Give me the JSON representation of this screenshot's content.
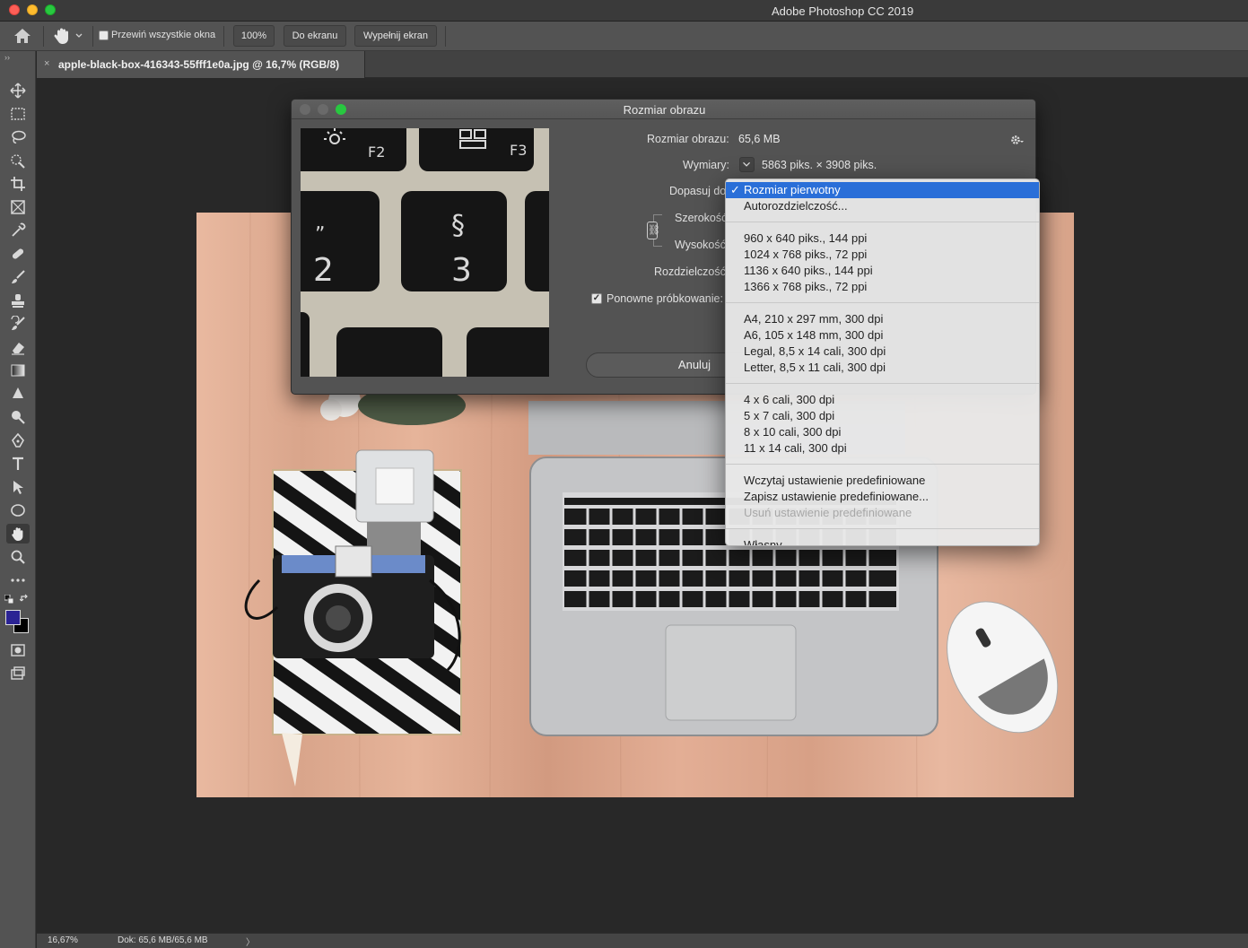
{
  "app": {
    "title": "Adobe Photoshop CC 2019"
  },
  "options_bar": {
    "scroll_all_label": "Przewiń wszystkie okna",
    "buttons": [
      "100%",
      "Do ekranu",
      "Wypełnij ekran"
    ]
  },
  "document": {
    "tab_title": "apple-black-box-416343-55fff1e0a.jpg @ 16,7% (RGB/8)",
    "close_glyph": "×"
  },
  "status_bar": {
    "zoom": "16,67%",
    "doc_info": "Dok: 65,6 MB/65,6 MB",
    "arrow": "〉"
  },
  "dialog": {
    "title": "Rozmiar obrazu",
    "image_size_label": "Rozmiar obrazu:",
    "image_size_value": "65,6 MB",
    "dimensions_label": "Wymiary:",
    "dimensions_value": "5863 piks. × 3908 piks.",
    "fit_to_label": "Dopasuj do:",
    "width_label": "Szerokość:",
    "height_label": "Wysokość:",
    "resolution_label": "Rozdzielczość:",
    "resample_label": "Ponowne próbkowanie:",
    "resample_checked": true,
    "cancel_button": "Anuluj"
  },
  "fit_menu": {
    "groups": [
      [
        {
          "label": "Rozmiar pierwotny",
          "selected": true
        },
        {
          "label": "Autorozdzielczość..."
        }
      ],
      [
        {
          "label": "960 x 640 piks., 144 ppi"
        },
        {
          "label": "1024 x 768 piks., 72 ppi"
        },
        {
          "label": "1136 x 640 piks., 144 ppi"
        },
        {
          "label": "1366 x 768 piks., 72 ppi"
        }
      ],
      [
        {
          "label": "A4, 210 x 297 mm, 300 dpi"
        },
        {
          "label": "A6, 105 x 148 mm, 300 dpi"
        },
        {
          "label": "Legal, 8,5 x 14 cali, 300 dpi"
        },
        {
          "label": "Letter, 8,5 x 11 cali, 300 dpi"
        }
      ],
      [
        {
          "label": "4 x 6 cali, 300 dpi"
        },
        {
          "label": "5 x 7 cali, 300 dpi"
        },
        {
          "label": "8 x 10 cali, 300 dpi"
        },
        {
          "label": "11 x 14 cali, 300 dpi"
        }
      ],
      [
        {
          "label": "Wczytaj ustawienie predefiniowane"
        },
        {
          "label": "Zapisz ustawienie predefiniowane..."
        },
        {
          "label": "Usuń ustawienie predefiniowane",
          "disabled": true
        }
      ],
      [
        {
          "label": "Własny"
        }
      ]
    ]
  },
  "preview_keys": {
    "f2": "F2",
    "f3": "F3",
    "key_quote": "„",
    "key_2": "2",
    "key_section": "§",
    "key_3": "3"
  },
  "colors": {
    "accent_selected": "#2a6fd8",
    "foreground_swatch": "#2b2394",
    "background_swatch": "#000000"
  },
  "tools": [
    "move-icon",
    "marquee-icon",
    "lasso-icon",
    "quick-select-icon",
    "crop-icon",
    "frame-icon",
    "eyedropper-icon",
    "healing-icon",
    "brush-icon",
    "stamp-icon",
    "history-brush-icon",
    "eraser-icon",
    "gradient-icon",
    "blur-icon",
    "dodge-icon",
    "pen-icon",
    "type-icon",
    "path-select-icon",
    "ellipse-icon",
    "hand-icon",
    "zoom-icon",
    "more-icon"
  ]
}
